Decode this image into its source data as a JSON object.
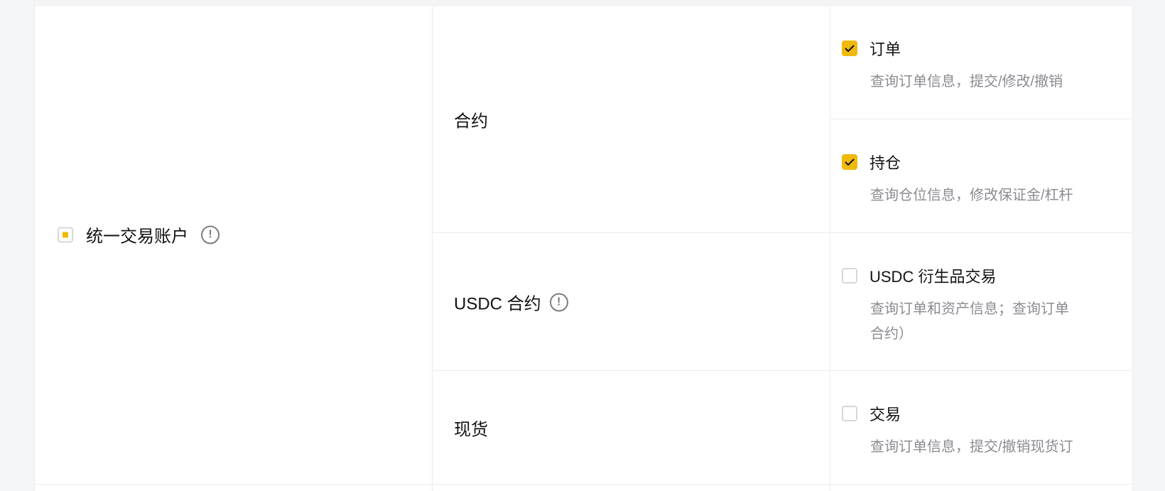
{
  "account": {
    "label": "统一交易账户",
    "checkbox_state": "indeterminate",
    "info_icon": "exclamation-circle-icon"
  },
  "categories": [
    {
      "label": "合约",
      "has_info": false
    },
    {
      "label": "USDC 合约",
      "has_info": true,
      "info_icon": "exclamation-circle-icon"
    },
    {
      "label": "现货",
      "has_info": false
    }
  ],
  "permissions": [
    {
      "title": "订单",
      "checked": true,
      "description": "查询订单信息，提交/修改/撤销"
    },
    {
      "title": "持仓",
      "checked": true,
      "description": "查询仓位信息，修改保证金/杠杆"
    },
    {
      "title": "USDC 衍生品交易",
      "checked": false,
      "description": "查询订单和资产信息；查询订单",
      "description_line2": "合约）"
    },
    {
      "title": "交易",
      "checked": false,
      "description": "查询订单信息，提交/撤销现货订"
    }
  ],
  "colors": {
    "accent": "#f0b90b",
    "border": "#ececee",
    "muted_text": "#8a8c91",
    "page_bg": "#f4f5f8"
  },
  "icons": {
    "info": "!"
  }
}
